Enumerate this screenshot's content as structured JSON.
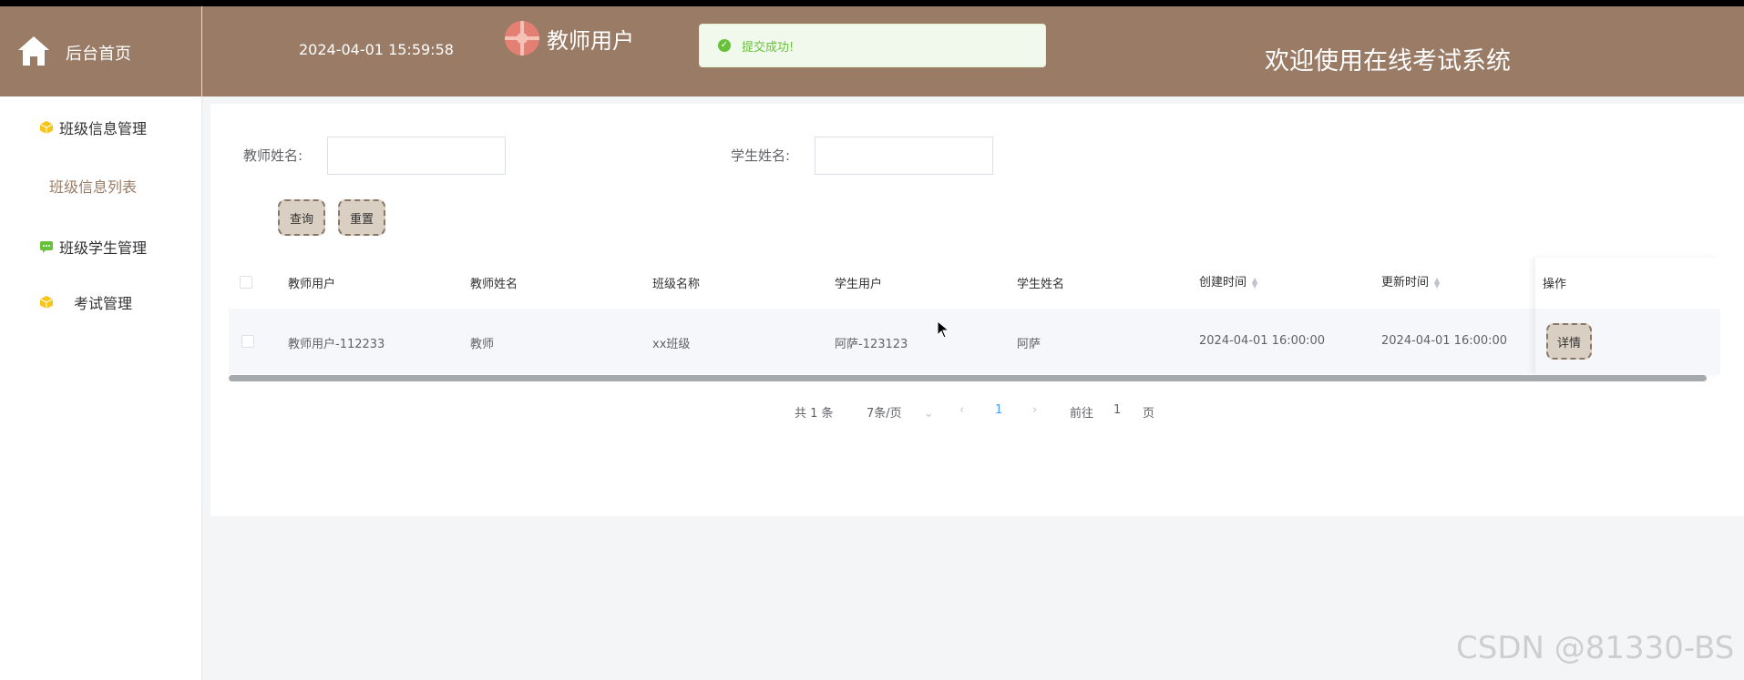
{
  "header": {
    "home_label": "后台首页",
    "datetime": "2024-04-01 15:59:58",
    "role": "教师用户",
    "welcome": "欢迎使用在线考试系统"
  },
  "toast": {
    "icon": "success-check-icon",
    "text": "提交成功!"
  },
  "sidebar": {
    "items": [
      {
        "label": "班级信息管理",
        "icon": "cube-icon"
      },
      {
        "label": "班级信息列表"
      },
      {
        "label": "班级学生管理",
        "icon": "chat-icon"
      },
      {
        "label": "考试管理",
        "icon": "cube-icon"
      }
    ]
  },
  "search": {
    "teacher_name_label": "教师姓名:",
    "teacher_name_value": "",
    "student_name_label": "学生姓名:",
    "student_name_value": "",
    "query_button": "查询",
    "reset_button": "重置"
  },
  "table": {
    "columns": [
      "教师用户",
      "教师姓名",
      "班级名称",
      "学生用户",
      "学生姓名",
      "创建时间",
      "更新时间",
      "操作"
    ],
    "rows": [
      {
        "teacher_user": "教师用户-112233",
        "teacher_name": "教师",
        "class_name": "xx班级",
        "student_user": "阿萨-123123",
        "student_name": "阿萨",
        "created": "2024-04-01 16:00:00",
        "updated": "2024-04-01 16:00:00",
        "detail_button": "详情"
      }
    ]
  },
  "pagination": {
    "total": "共 1 条",
    "page_size": "7条/页",
    "current_page": "1",
    "goto_prefix": "前往",
    "goto_value": "1",
    "goto_suffix": "页"
  },
  "watermark": "CSDN @81330-BS",
  "colors": {
    "header_bg": "#9a7b66",
    "success": "#67c23a",
    "accent": "#409eff"
  }
}
